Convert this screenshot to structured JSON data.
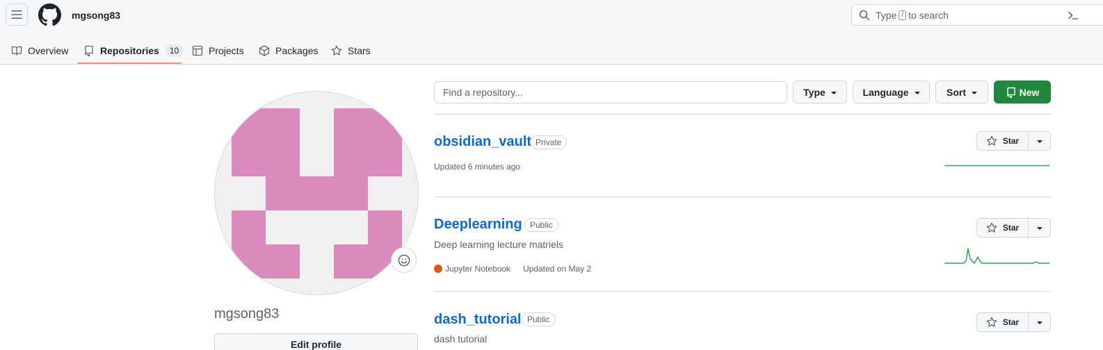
{
  "header": {
    "username": "mgsong83",
    "search": {
      "prefix": "Type",
      "key": "/",
      "suffix": "to search"
    }
  },
  "tabs": [
    {
      "label": "Overview"
    },
    {
      "label": "Repositories",
      "count": "10",
      "active": true
    },
    {
      "label": "Projects"
    },
    {
      "label": "Packages"
    },
    {
      "label": "Stars"
    }
  ],
  "profile": {
    "name": "mgsong83",
    "edit_label": "Edit profile",
    "avatar_color": "#d88bbc"
  },
  "filters": {
    "find_placeholder": "Find a repository...",
    "type_label": "Type",
    "language_label": "Language",
    "sort_label": "Sort",
    "new_label": "New"
  },
  "repos": [
    {
      "name": "obsidian_vault",
      "visibility": "Private",
      "description": "",
      "language": "",
      "updated": "Updated 6 minutes ago",
      "star_label": "Star"
    },
    {
      "name": "Deeplearning",
      "visibility": "Public",
      "description": "Deep learning lecture matriels",
      "language": "Jupyter Notebook",
      "language_color": "#DA5B0B",
      "updated": "Updated on May 2",
      "star_label": "Star"
    },
    {
      "name": "dash_tutorial",
      "visibility": "Public",
      "description": "dash tutorial",
      "language": "",
      "updated": "",
      "star_label": "Star"
    }
  ],
  "colors": {
    "accent": "#0969da",
    "new_button": "#1f883d",
    "tab_underline": "#fd8c73",
    "sparkline": "#2da44e"
  }
}
